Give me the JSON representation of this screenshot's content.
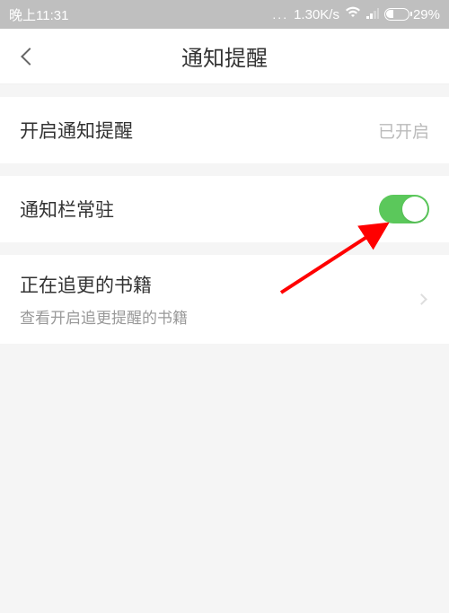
{
  "status_bar": {
    "time": "晚上11:31",
    "dots": "...",
    "speed": "1.30K/s",
    "battery_percent": "29%"
  },
  "header": {
    "title": "通知提醒"
  },
  "rows": {
    "notification_toggle": {
      "label": "开启通知提醒",
      "value": "已开启"
    },
    "persistent_bar": {
      "label": "通知栏常驻"
    },
    "following_books": {
      "label": "正在追更的书籍",
      "subtitle": "查看开启追更提醒的书籍"
    }
  }
}
